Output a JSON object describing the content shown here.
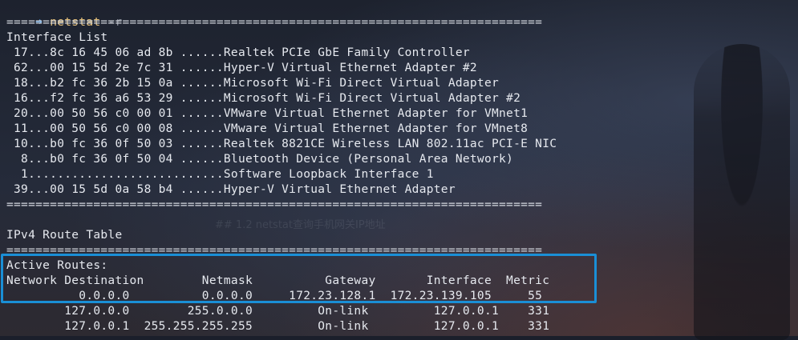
{
  "prompt": {
    "arrow": "➜",
    "command": "netstat",
    "args": "-r"
  },
  "separator": "==========================================================================",
  "interface_list": {
    "heading": "Interface List",
    "rows": [
      " 17...8c 16 45 06 ad 8b ......Realtek PCIe GbE Family Controller",
      " 62...00 15 5d 2e 7c 31 ......Hyper-V Virtual Ethernet Adapter #2",
      " 18...b2 fc 36 2b 15 0a ......Microsoft Wi-Fi Direct Virtual Adapter",
      " 16...f2 fc 36 a6 53 29 ......Microsoft Wi-Fi Direct Virtual Adapter #2",
      " 20...00 50 56 c0 00 01 ......VMware Virtual Ethernet Adapter for VMnet1",
      " 11...00 50 56 c0 00 08 ......VMware Virtual Ethernet Adapter for VMnet8",
      " 10...b0 fc 36 0f 50 03 ......Realtek 8821CE Wireless LAN 802.11ac PCI-E NIC",
      "  8...b0 fc 36 0f 50 04 ......Bluetooth Device (Personal Area Network)",
      "  1...........................Software Loopback Interface 1",
      " 39...00 15 5d 0a 58 b4 ......Hyper-V Virtual Ethernet Adapter"
    ]
  },
  "route_table": {
    "heading": "IPv4 Route Table",
    "active_label": "Active Routes:",
    "header": "Network Destination        Netmask          Gateway       Interface  Metric",
    "rows": [
      "          0.0.0.0          0.0.0.0     172.23.128.1  172.23.139.105     55",
      "        127.0.0.0        255.0.0.0         On-link         127.0.0.1    331",
      "        127.0.0.1  255.255.255.255         On-link         127.0.0.1    331"
    ]
  },
  "background_text": {
    "top_fragment": "##",
    "middle_fragment": "## 1.2 netstat查询手机网关IP地址"
  },
  "colors": {
    "highlight_border": "#1a8fd6",
    "prompt_arrow": "#5ea3e6",
    "command": "#e5c07b"
  }
}
